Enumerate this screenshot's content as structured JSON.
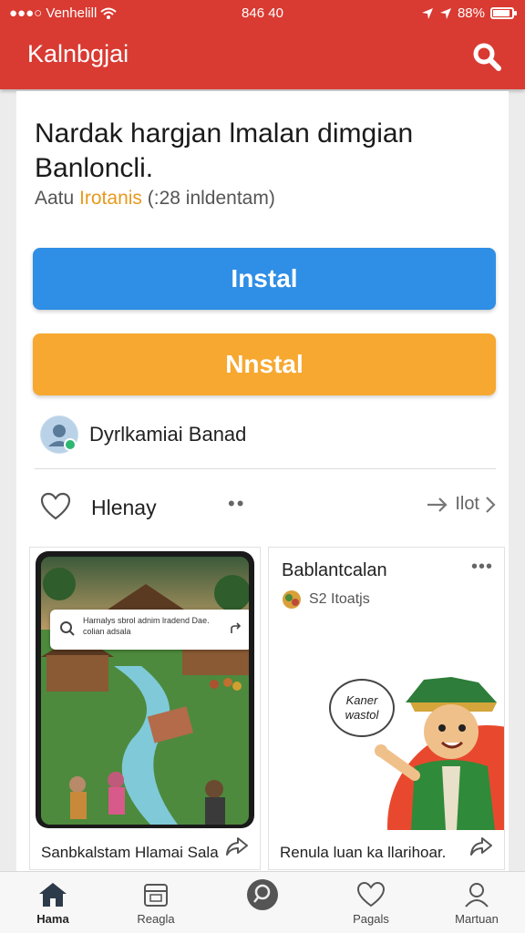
{
  "status_bar": {
    "carrier": "●●●○ Venhelill",
    "time": "846 40",
    "battery_text": "88%",
    "battery_level": 0.88
  },
  "app_bar": {
    "title": "Kalnbgjai",
    "search_icon": "search-icon"
  },
  "listing": {
    "headline": "Nardak hargjan lmalan dimgian Banloncli.",
    "meta_prefix": "Aatu ",
    "meta_highlight": "Irotanis",
    "meta_suffix": " (:28 inldentam)",
    "primary_button": "Instal",
    "secondary_button": "Nnstal",
    "publisher_name": "Dyrlkamiai Banad"
  },
  "actions": {
    "like_label": "Hlenay",
    "more_dots": "••",
    "share_label": "Ilot"
  },
  "tiles": {
    "left": {
      "search_text": "Harnalys sbrol adnim lradend Dae. colian adsala",
      "caption": "Sanbkalstam Hlamai Sala"
    },
    "right": {
      "title": "Bablantcalan",
      "subtitle": "S2 Itoatjs",
      "bubble_text": "Kaner wastol",
      "caption": "Renula luan ka llarihoar."
    }
  },
  "bottom_nav": [
    {
      "label": "Hama",
      "icon": "home-icon",
      "active": true
    },
    {
      "label": "Reagla",
      "icon": "calendar-icon",
      "active": false
    },
    {
      "label": "",
      "icon": "search-circle-icon",
      "active": false
    },
    {
      "label": "Pagals",
      "icon": "heart-icon",
      "active": false
    },
    {
      "label": "Martuan",
      "icon": "profile-icon",
      "active": false
    }
  ],
  "colors": {
    "app_bar": "#d93a32",
    "primary_button": "#2f8ee5",
    "secondary_button": "#f7a830",
    "meta_highlight": "#e69a1e"
  }
}
